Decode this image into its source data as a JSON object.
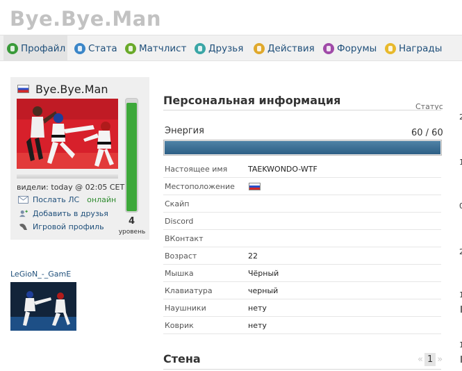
{
  "header": {
    "title": "Bye.Bye.Man"
  },
  "tabs": [
    {
      "label": "Профайл",
      "icon": "profile-icon",
      "color": "#3a9a3a",
      "active": true
    },
    {
      "label": "Стата",
      "icon": "info-icon",
      "color": "#3b86c8",
      "active": false
    },
    {
      "label": "Матчлист",
      "icon": "radiation-icon",
      "color": "#6aaa2a",
      "active": false
    },
    {
      "label": "Друзья",
      "icon": "friends-icon",
      "color": "#3aa6a6",
      "active": false
    },
    {
      "label": "Действия",
      "icon": "actions-icon",
      "color": "#e0a92c",
      "active": false
    },
    {
      "label": "Форумы",
      "icon": "forums-icon",
      "color": "#a04aa8",
      "active": false
    },
    {
      "label": "Награды",
      "icon": "awards-icon",
      "color": "#e8b92c",
      "active": false
    }
  ],
  "profile": {
    "name": "Bye.Bye.Man",
    "flag_icon": "russia-flag-icon",
    "last_seen": "видели: today @ 02:05 CET",
    "send_pm": "Послать ЛС",
    "online": "онлайн",
    "add_friend": "Добавить в друзья",
    "game_profile": "Игровой профиль",
    "level": "4",
    "level_label": "уровень",
    "level_fill_fraction": 0.97
  },
  "friend": {
    "name": "LeGioN_-_GamE"
  },
  "personal": {
    "title": "Персональная информация",
    "status_label": "Статус",
    "energy_label": "Энергия",
    "energy_value": "60 / 60",
    "energy_fraction": 1.0,
    "rows": [
      {
        "label": "Настоящее имя",
        "value": "TAEKWONDO-WTF"
      },
      {
        "label": "Местоположение",
        "value": "",
        "flag": true
      },
      {
        "label": "Скайп",
        "value": ""
      },
      {
        "label": "Discord",
        "value": ""
      },
      {
        "label": "ВКонтакт",
        "value": ""
      },
      {
        "label": "Возраст",
        "value": "22"
      },
      {
        "label": "Мышка",
        "value": "Чёрный"
      },
      {
        "label": "Клавиатура",
        "value": "черный"
      },
      {
        "label": "Наушники",
        "value": "нету"
      },
      {
        "label": "Коврик",
        "value": "нету"
      }
    ]
  },
  "wall": {
    "title": "Стена",
    "prev": "«",
    "page": "1",
    "next": "»"
  },
  "right_column": {
    "fragments": [
      "2",
      "1",
      "0",
      "2",
      "1",
      "1"
    ]
  }
}
